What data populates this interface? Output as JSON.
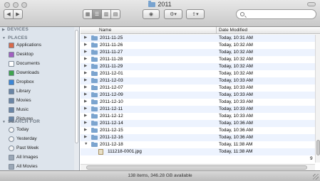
{
  "window": {
    "title": "2011"
  },
  "toolbar": {
    "back_glyph": "◀",
    "forward_glyph": "▶",
    "view_icon_glyph": "▦",
    "view_list_glyph": "☰",
    "view_column_glyph": "▥",
    "view_coverflow_glyph": "▤",
    "quicklook_glyph": "◉",
    "action_glyph": "⚙▾",
    "share_glyph": "⇪▾"
  },
  "sidebar": {
    "sections": [
      {
        "label": "DEVICES"
      },
      {
        "label": "PLACES"
      },
      {
        "label": "SEARCH FOR"
      }
    ],
    "places": [
      {
        "label": "Applications",
        "icon": "applications-icon",
        "color": "#d86a4a"
      },
      {
        "label": "Desktop",
        "icon": "desktop-icon",
        "color": "#a25fc0"
      },
      {
        "label": "Documents",
        "icon": "documents-icon",
        "color": "#ffffff"
      },
      {
        "label": "Downloads",
        "icon": "downloads-icon",
        "color": "#3fa34d"
      },
      {
        "label": "Dropbox",
        "icon": "dropbox-icon",
        "color": "#3b86d6"
      },
      {
        "label": "Library",
        "icon": "library-icon",
        "color": "#6b86a6"
      },
      {
        "label": "Movies",
        "icon": "movies-icon",
        "color": "#6b86a6"
      },
      {
        "label": "Music",
        "icon": "music-icon",
        "color": "#6b86a6"
      },
      {
        "label": "Pictures",
        "icon": "pictures-icon",
        "color": "#6b86a6"
      }
    ],
    "search_for": [
      {
        "label": "Today",
        "icon": "clock-icon"
      },
      {
        "label": "Yesterday",
        "icon": "clock-icon"
      },
      {
        "label": "Past Week",
        "icon": "clock-icon"
      },
      {
        "label": "All Images",
        "icon": "images-icon"
      },
      {
        "label": "All Movies",
        "icon": "movies-icon"
      },
      {
        "label": "All Documents",
        "icon": "documents-icon"
      }
    ]
  },
  "columns": {
    "name": "Name",
    "date": "Date Modified"
  },
  "rows": [
    {
      "name": "2011-11-25",
      "date": "Today, 10:31 AM"
    },
    {
      "name": "2011-11-26",
      "date": "Today, 10:32 AM"
    },
    {
      "name": "2011-11-27",
      "date": "Today, 10:32 AM"
    },
    {
      "name": "2011-11-28",
      "date": "Today, 10:32 AM"
    },
    {
      "name": "2011-11-29",
      "date": "Today, 10:32 AM"
    },
    {
      "name": "2011-12-01",
      "date": "Today, 10:32 AM"
    },
    {
      "name": "2011-12-03",
      "date": "Today, 10:33 AM"
    },
    {
      "name": "2011-12-07",
      "date": "Today, 10:33 AM"
    },
    {
      "name": "2011-12-09",
      "date": "Today, 10:33 AM"
    },
    {
      "name": "2011-12-10",
      "date": "Today, 10:33 AM"
    },
    {
      "name": "2011-12-11",
      "date": "Today, 10:33 AM"
    },
    {
      "name": "2011-12-12",
      "date": "Today, 10:33 AM"
    },
    {
      "name": "2011-12-14",
      "date": "Today, 10:36 AM"
    },
    {
      "name": "2011-12-15",
      "date": "Today, 10:36 AM"
    },
    {
      "name": "2011-12-16",
      "date": "Today, 10:36 AM"
    },
    {
      "name": "2011-12-18",
      "date": "Today, 11:38 AM",
      "expanded": true
    },
    {
      "name": "111218-0001.jpg",
      "date": "Today, 11:38 AM",
      "child": true
    }
  ],
  "trailing_cut": "9",
  "status": "138 items, 346.28 GB available"
}
